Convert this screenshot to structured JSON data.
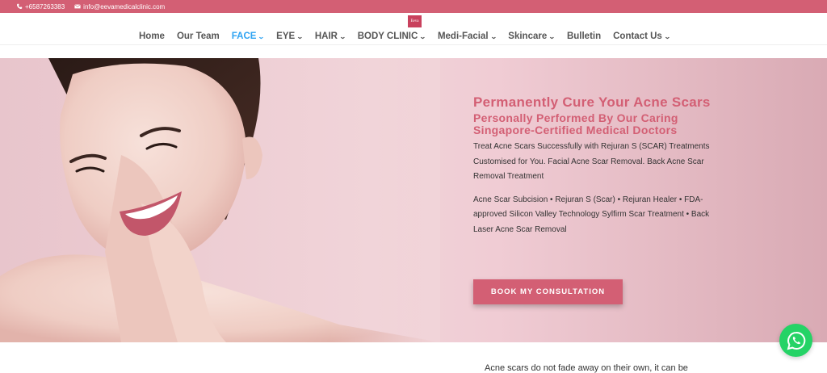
{
  "topbar": {
    "phone": "+6587263383",
    "email": "info@eevamedicalclinic.com"
  },
  "brand": {
    "logo_text": "Eeva"
  },
  "nav": {
    "items": [
      {
        "label": "Home",
        "has_dropdown": false,
        "active": false
      },
      {
        "label": "Our Team",
        "has_dropdown": false,
        "active": false
      },
      {
        "label": "FACE",
        "has_dropdown": true,
        "active": true
      },
      {
        "label": "EYE",
        "has_dropdown": true,
        "active": false
      },
      {
        "label": "HAIR",
        "has_dropdown": true,
        "active": false
      },
      {
        "label": "BODY CLINIC",
        "has_dropdown": true,
        "active": false
      },
      {
        "label": "Medi-Facial",
        "has_dropdown": true,
        "active": false
      },
      {
        "label": "Skincare",
        "has_dropdown": true,
        "active": false
      },
      {
        "label": "Bulletin",
        "has_dropdown": false,
        "active": false
      },
      {
        "label": "Contact Us",
        "has_dropdown": true,
        "active": false
      }
    ]
  },
  "hero": {
    "title": "Permanently Cure Your Acne Scars",
    "subtitle": "Personally Performed By Our Caring Singapore-Certified Medical Doctors",
    "paragraph1": "Treat Acne Scars Successfully with Rejuran S (SCAR) Treatments Customised for You. Facial Acne Scar Removal. Back Acne Scar Removal Treatment",
    "paragraph2": "Acne Scar Subcision • Rejuran S (Scar) • Rejuran Healer • FDA-approved Silicon Valley Technology Sylfirm Scar Treatment • Back Laser Acne Scar Removal",
    "cta_label": "BOOK MY CONSULTATION"
  },
  "below": {
    "text": "Acne scars do not fade away on their own, it can be"
  },
  "colors": {
    "brand": "#d35f74",
    "nav_active": "#2ea3f2",
    "whatsapp": "#25d366"
  },
  "icons": {
    "phone": "phone-icon",
    "email": "envelope-icon",
    "chat": "whatsapp-icon",
    "dropdown": "chevron-down-icon"
  }
}
